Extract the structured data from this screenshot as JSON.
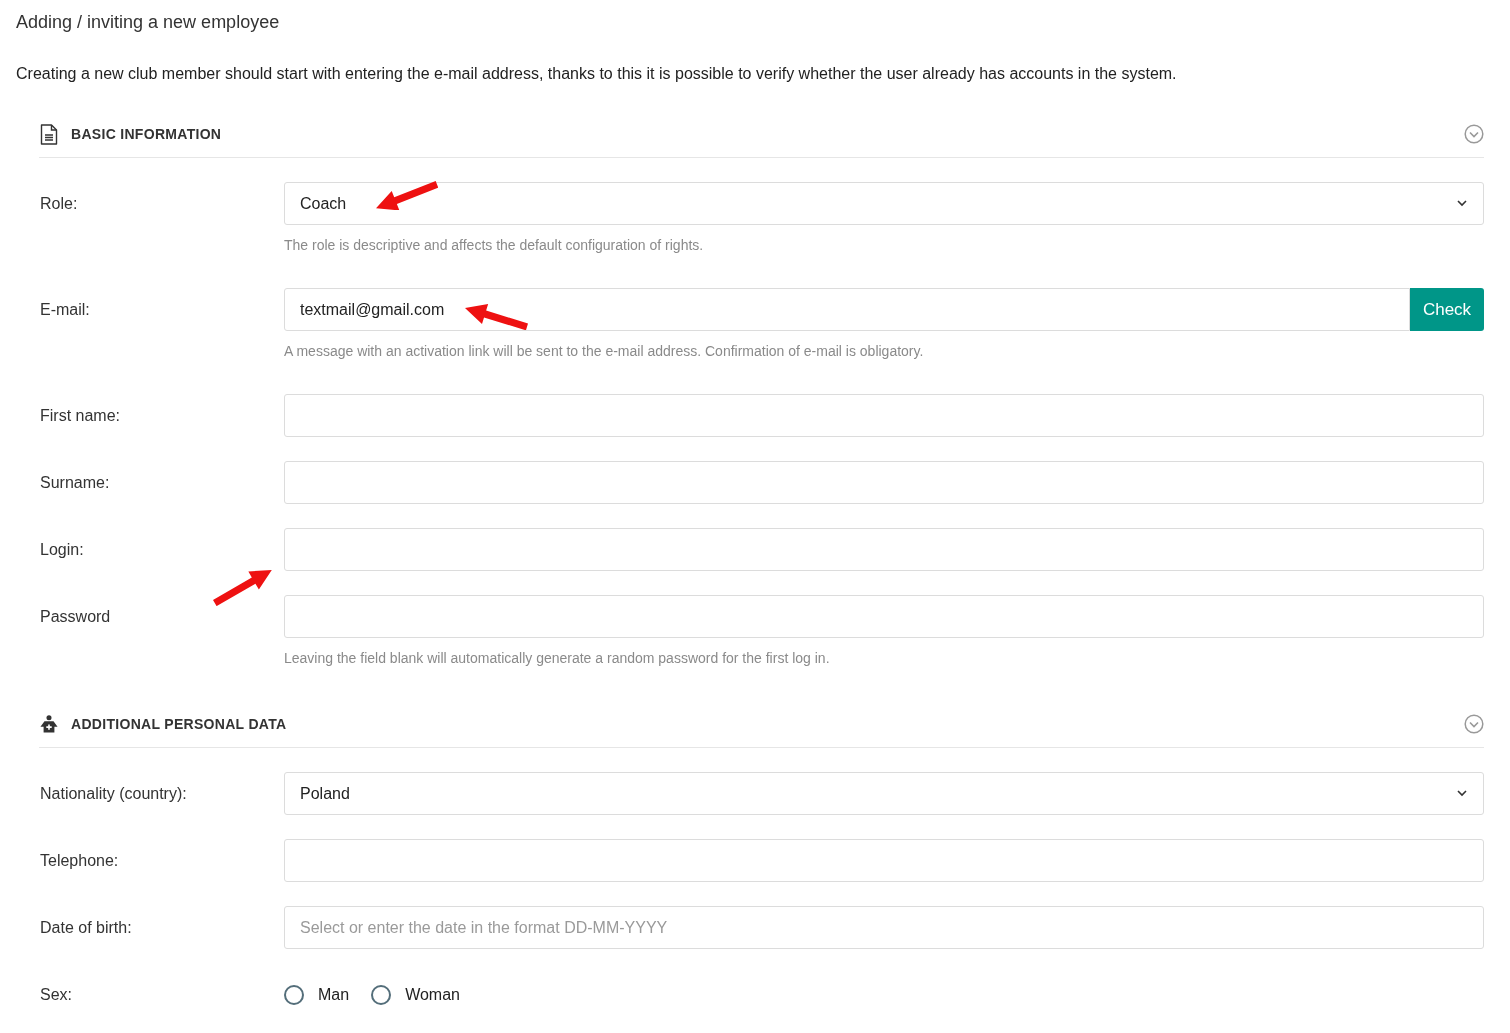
{
  "page": {
    "title": "Adding / inviting a new employee",
    "description": "Creating a new club member should start with entering the e-mail address, thanks to this it is possible to verify whether the user already has accounts in the system."
  },
  "sections": [
    {
      "title": "BASIC INFORMATION",
      "fields": [
        {
          "kind": "select",
          "label": "Role:",
          "value": "Coach",
          "hint": "The role is descriptive and affects the default configuration of rights."
        },
        {
          "kind": "input",
          "label": "E-mail:",
          "value": "textmail@gmail.com",
          "button": "Check",
          "hint": "A message with an activation link will be sent to the e-mail address. Confirmation of e-mail is obligatory."
        },
        {
          "kind": "input",
          "label": "First name:"
        },
        {
          "kind": "input",
          "label": "Surname:"
        },
        {
          "kind": "input",
          "label": "Login:"
        },
        {
          "kind": "input",
          "label": "Password",
          "hint": "Leaving the field blank will automatically generate a random password for the first log in."
        }
      ]
    },
    {
      "title": "ADDITIONAL PERSONAL DATA",
      "fields": [
        {
          "kind": "select",
          "label": "Nationality (country):",
          "value": "Poland"
        },
        {
          "kind": "input",
          "label": "Telephone:"
        },
        {
          "kind": "input",
          "label": "Date of birth:",
          "placeholder": "Select or enter the date in the format DD-MM-YYYY"
        },
        {
          "kind": "radio",
          "label": "Sex:",
          "options": [
            {
              "label": "Man",
              "selected": false
            },
            {
              "label": "Woman",
              "selected": false
            }
          ]
        }
      ]
    }
  ]
}
